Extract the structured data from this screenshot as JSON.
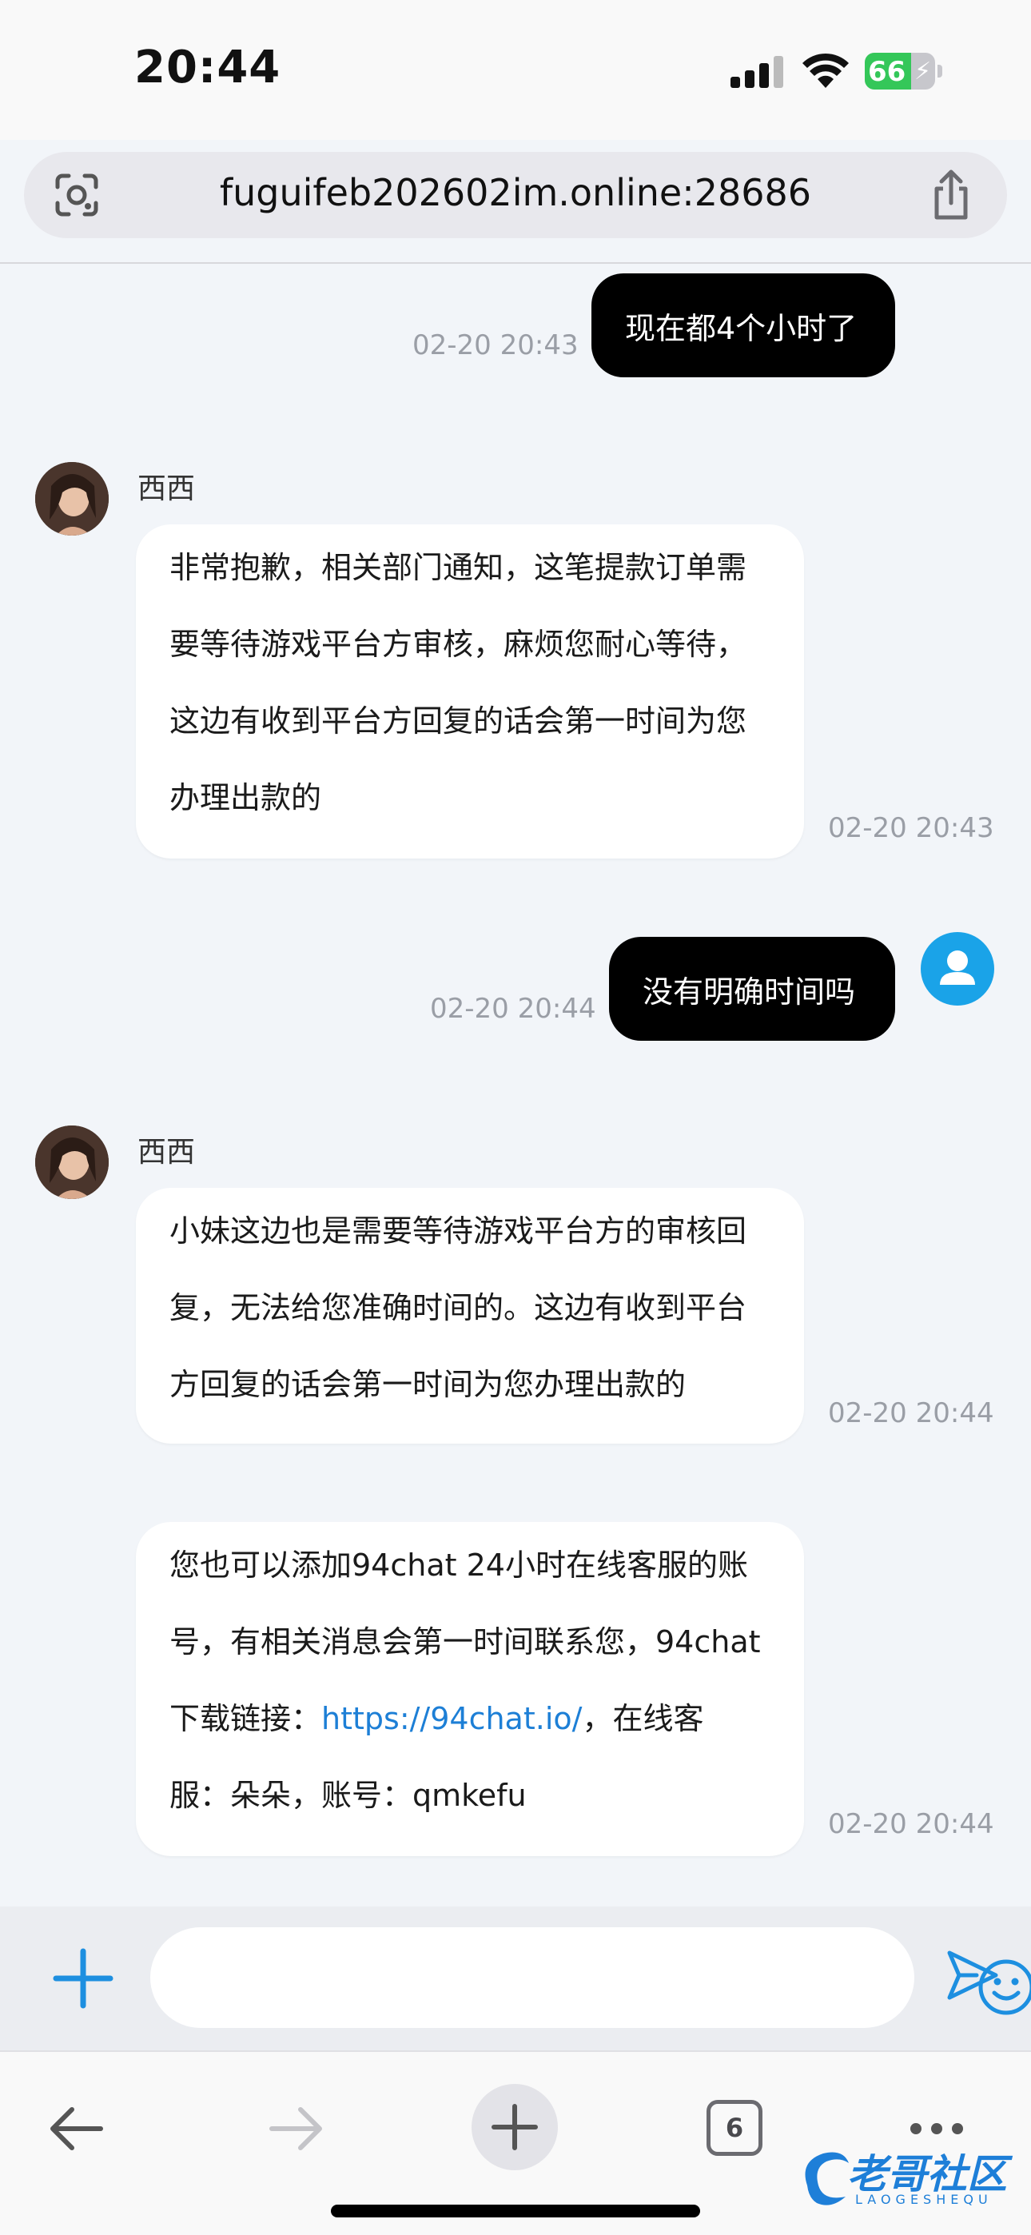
{
  "status_bar": {
    "time": "20:44",
    "battery": "66",
    "battery_level": 0.66
  },
  "browser": {
    "url": "fuguifeb202602im.online:28686",
    "tab_count": "6"
  },
  "messages": [
    {
      "direction": "out",
      "text": "现在都4个小时了",
      "time": "02-20 20:43"
    },
    {
      "direction": "in",
      "sender": "西西",
      "lines": [
        "非常抱歉，相关部门通知，这笔提款订单需",
        "要等待游戏平台方审核，麻烦您耐心等待，",
        "这边有收到平台方回复的话会第一时间为您",
        "办理出款的"
      ],
      "time": "02-20 20:43"
    },
    {
      "direction": "out",
      "text": "没有明确时间吗",
      "time": "02-20 20:44"
    },
    {
      "direction": "in",
      "sender": "西西",
      "lines": [
        "小妹这边也是需要等待游戏平台方的审核回",
        "复，无法给您准确时间的。这边有收到平台",
        "方回复的话会第一时间为您办理出款的"
      ],
      "time": "02-20 20:44"
    },
    {
      "direction": "in",
      "lines": [
        "您也可以添加94chat 24小时在线客服的账",
        "号，有相关消息会第一时间联系您，94chat",
        "下载链接：",
        "https://94chat.io/",
        "，在线客",
        "服：朵朵，账号：qmkefu"
      ],
      "time": "02-20 20:44"
    }
  ],
  "composer": {
    "placeholder": ""
  },
  "watermark": {
    "text": "老哥社区",
    "sub": "LAOGESHEQU"
  },
  "colors": {
    "accent": "#1d7fd6",
    "outgoing_bubble": "#000000",
    "incoming_bubble": "#ffffff",
    "chat_bg": "#f2f5f9",
    "battery": "#34c759"
  },
  "icons": {
    "lens": "google-lens-icon",
    "share": "share-icon",
    "add": "plus-icon",
    "emoji": "smiley-icon",
    "send": "send-icon",
    "back": "back-arrow-icon",
    "forward": "forward-arrow-icon",
    "new_tab": "new-tab-plus-icon",
    "tabs": "tabs-icon",
    "more": "more-dots-icon"
  }
}
